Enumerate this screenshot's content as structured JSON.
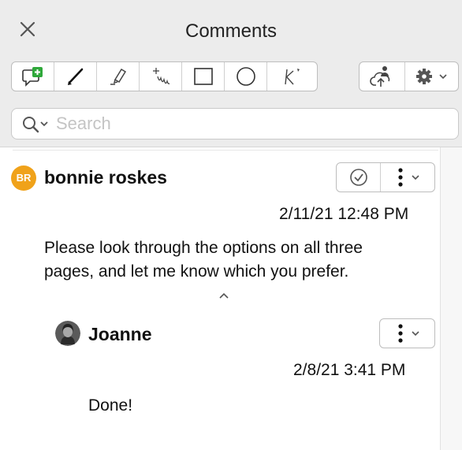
{
  "header": {
    "title": "Comments",
    "close_icon": "close-icon"
  },
  "toolbar": {
    "drawing_tools": [
      "add-comment-icon",
      "pen-line-icon",
      "highlighter-icon",
      "freehand-icon",
      "rectangle-icon",
      "ellipse-icon",
      "callout-icon"
    ],
    "share_icon": "share-cloud-icon",
    "settings_icon": "gear-icon"
  },
  "search": {
    "placeholder": "Search",
    "value": ""
  },
  "comments": [
    {
      "author": "bonnie roskes",
      "initials": "BR",
      "avatar_color": "#f0a21a",
      "timestamp": "2/11/21 12:48 PM",
      "text_lines": [
        "Please look through the options on all three",
        "pages, and let me know which you prefer."
      ],
      "replies": [
        {
          "author": "Joanne",
          "timestamp": "2/8/21 3:41 PM",
          "text": "Done!"
        }
      ]
    }
  ],
  "colors": {
    "panel_bg": "#ececec",
    "accent_avatar": "#f0a21a",
    "green_plus": "#2fa83a"
  }
}
